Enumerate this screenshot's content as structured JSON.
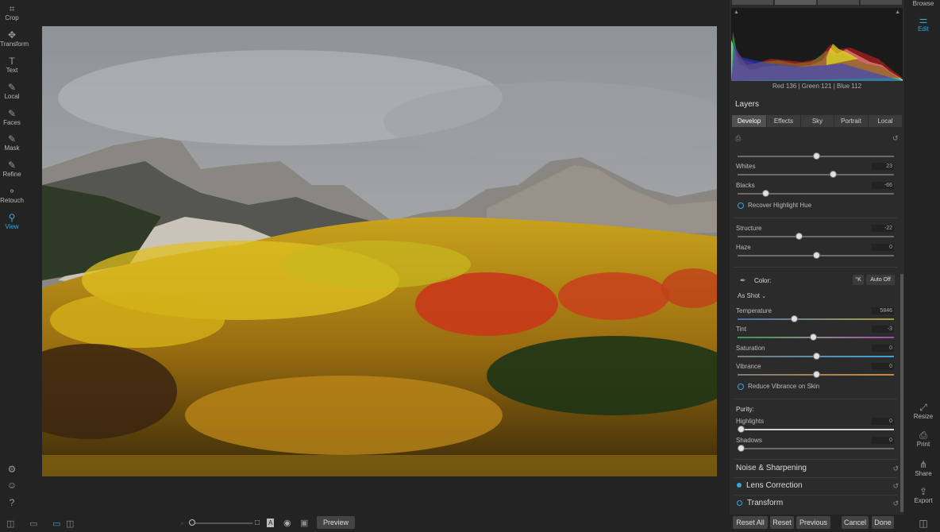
{
  "left_tools": [
    {
      "label": "Crop",
      "icon": "crop-icon",
      "glyph": "⌗"
    },
    {
      "label": "Transform",
      "icon": "transform-icon",
      "glyph": "✥"
    },
    {
      "label": "Text",
      "icon": "text-icon",
      "glyph": "T"
    },
    {
      "label": "Local",
      "icon": "brush-icon",
      "glyph": "✎"
    },
    {
      "label": "Faces",
      "icon": "faces-icon",
      "glyph": "✎"
    },
    {
      "label": "Mask",
      "icon": "mask-icon",
      "glyph": "✎"
    },
    {
      "label": "Refine",
      "icon": "refine-icon",
      "glyph": "✎"
    },
    {
      "label": "Retouch",
      "icon": "retouch-icon",
      "glyph": "⚬"
    },
    {
      "label": "View",
      "icon": "view-icon",
      "glyph": "⚲"
    }
  ],
  "right_bar": {
    "browse": "Browse",
    "edit": "Edit",
    "resize": "Resize",
    "print": "Print",
    "share": "Share",
    "export": "Export"
  },
  "histogram": {
    "readout": "Red 136 | Green 121 | Blue 112"
  },
  "layers": {
    "title": "Layers",
    "tabs": [
      "Develop",
      "Effects",
      "Sky",
      "Portrait",
      "Local"
    ],
    "selected_tab": "Develop"
  },
  "sliders_tone": [
    {
      "label": "Whites",
      "value": "23",
      "pos": 0.61
    },
    {
      "label": "Blacks",
      "value": "-66",
      "pos": 0.18
    }
  ],
  "top_slider_pos": 0.5,
  "recover_highlight": "Recover Highlight Hue",
  "sliders_detail": [
    {
      "label": "Structure",
      "value": "-22",
      "pos": 0.39
    },
    {
      "label": "Haze",
      "value": "0",
      "pos": 0.5
    }
  ],
  "color": {
    "title": "Color:",
    "k_button": "°K",
    "auto_off": "Auto Off",
    "preset": "As Shot",
    "sliders": [
      {
        "label": "Temperature",
        "value": "5846",
        "pos": 0.36
      },
      {
        "label": "Tint",
        "value": "-3",
        "pos": 0.48
      },
      {
        "label": "Saturation",
        "value": "0",
        "pos": 0.5
      },
      {
        "label": "Vibrance",
        "value": "0",
        "pos": 0.5
      }
    ],
    "reduce_vibrance": "Reduce Vibrance on Skin"
  },
  "purity": {
    "title": "Purity:",
    "sliders": [
      {
        "label": "Highlights",
        "value": "0",
        "pos": 0.02
      },
      {
        "label": "Shadows",
        "value": "0",
        "pos": 0.02
      }
    ]
  },
  "sections": [
    {
      "label": "Noise & Sharpening",
      "dot": "none"
    },
    {
      "label": "Lens Correction",
      "dot": "filled"
    },
    {
      "label": "Transform",
      "dot": "ring"
    }
  ],
  "bottom": {
    "preview": "Preview",
    "reset_all": "Reset All",
    "reset": "Reset",
    "previous": "Previous",
    "cancel": "Cancel",
    "done": "Done"
  },
  "colors": {
    "accent": "#3aa3d8"
  }
}
